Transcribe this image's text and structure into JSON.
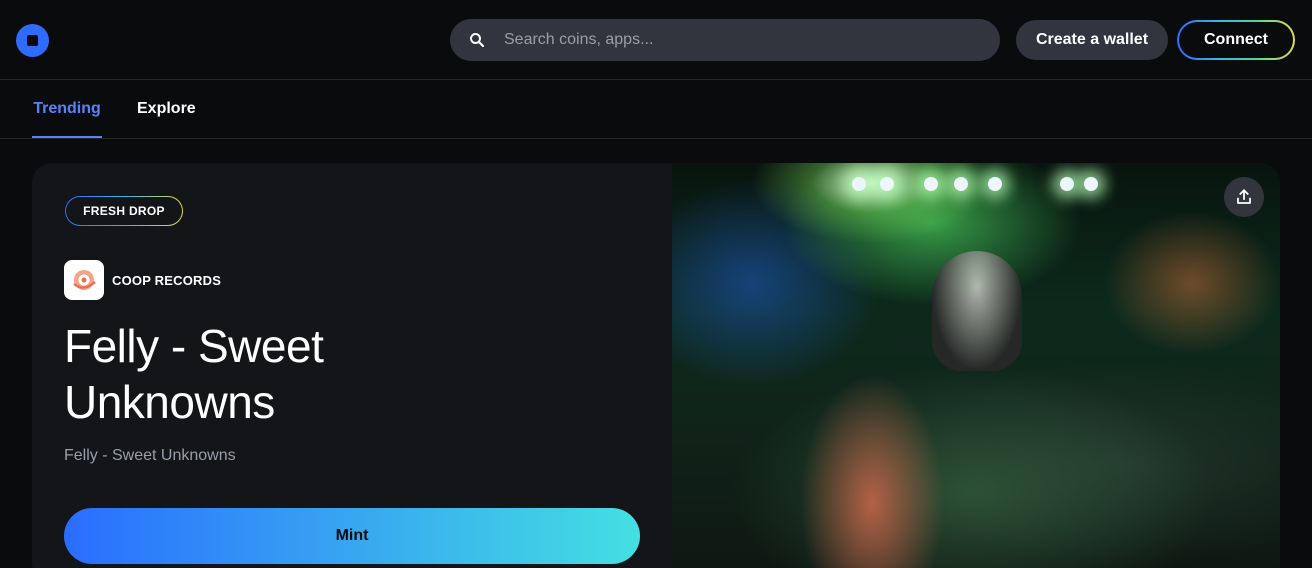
{
  "header": {
    "search": {
      "placeholder": "Search coins, apps..."
    },
    "create_wallet_label": "Create a wallet",
    "connect_label": "Connect"
  },
  "tabs": [
    {
      "label": "Trending",
      "active": true
    },
    {
      "label": "Explore",
      "active": false
    }
  ],
  "hero": {
    "badge": "FRESH DROP",
    "creator": "COOP RECORDS",
    "title": "Felly - Sweet Unknowns",
    "subtitle": "Felly - Sweet Unknowns",
    "mint_label": "Mint",
    "image_alt": "concert-crowd-photo"
  },
  "icons": {
    "logo": "coinbase-logo-icon",
    "search": "search-icon",
    "share": "share-icon"
  },
  "colors": {
    "accent": "#2f6bff",
    "tab_active": "#5783ff",
    "background": "#0a0b0d",
    "card": "#141519",
    "mint_gradient_start": "#2a6dff",
    "mint_gradient_end": "#44e0e2"
  }
}
